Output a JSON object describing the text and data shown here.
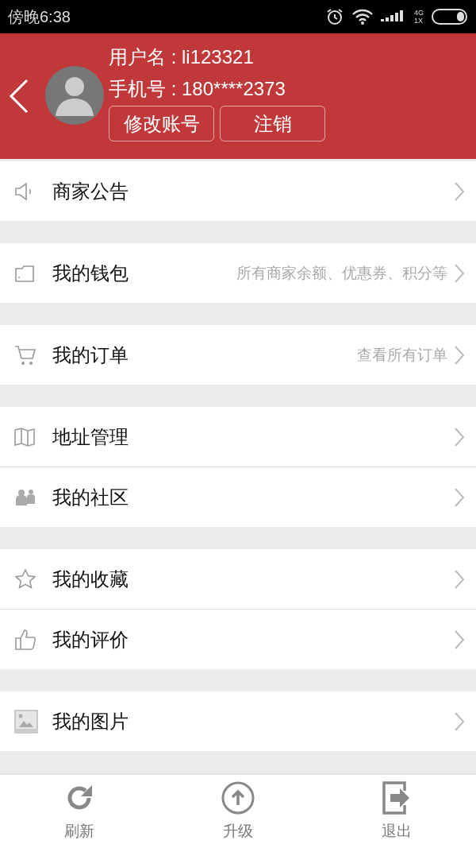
{
  "status_bar": {
    "time": "傍晚6:38",
    "network_top": "4G",
    "network_bottom": "1X"
  },
  "header": {
    "username": "用户名 : li123321",
    "phone": "手机号 : 180****2373",
    "buttons": [
      "修改账号",
      "注销"
    ]
  },
  "groups": [
    [
      {
        "label": "商家公告"
      }
    ],
    [
      {
        "label": "我的钱包",
        "detail": "所有商家余额、优惠券、积分等"
      }
    ],
    [
      {
        "label": "我的订单",
        "detail": "查看所有订单"
      }
    ],
    [
      {
        "label": "地址管理"
      },
      {
        "label": "我的社区"
      }
    ],
    [
      {
        "label": "我的收藏"
      },
      {
        "label": "我的评价"
      }
    ],
    [
      {
        "label": "我的图片"
      }
    ]
  ],
  "tab_bar": [
    {
      "label": "刷新"
    },
    {
      "label": "升级"
    },
    {
      "label": "退出"
    }
  ]
}
